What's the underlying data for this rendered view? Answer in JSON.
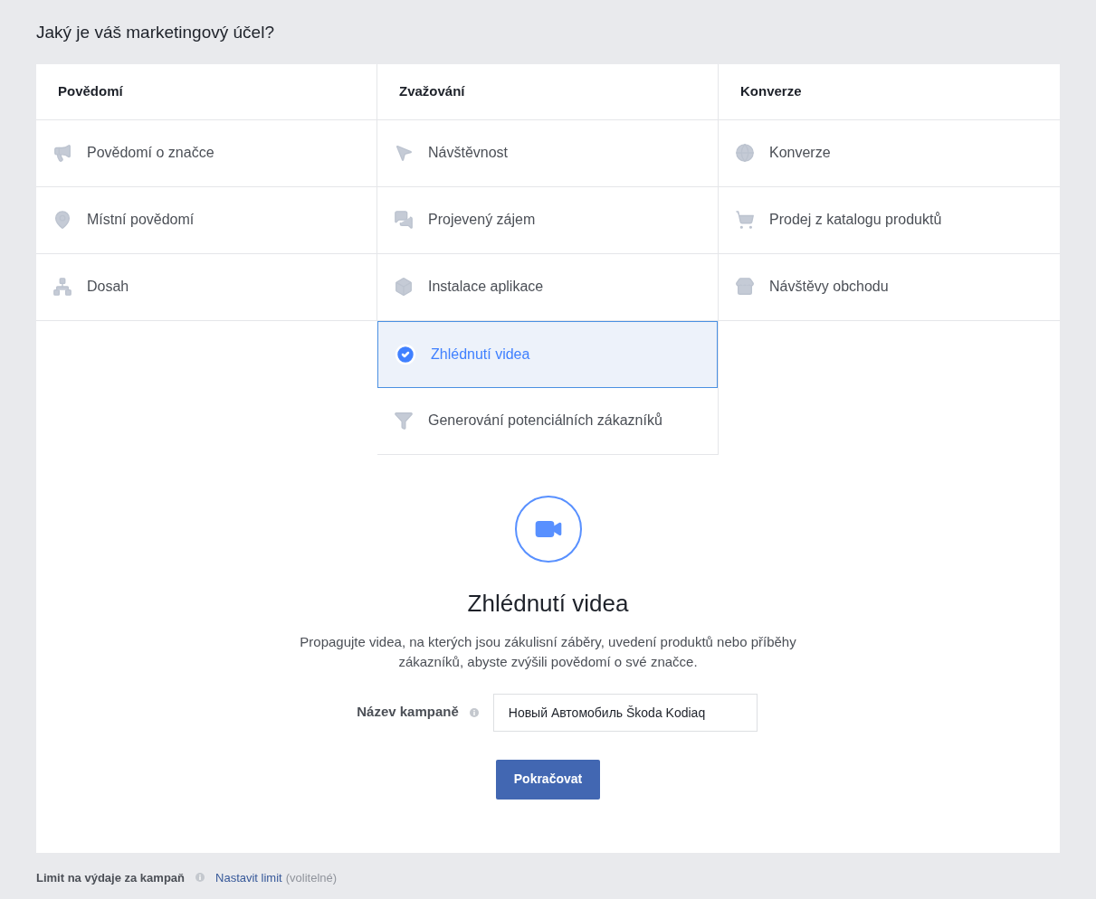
{
  "title": "Jaký je váš marketingový účel?",
  "columns": [
    {
      "heading": "Povědomí",
      "items": [
        {
          "label": "Povědomí o značce",
          "kind": "megaphone",
          "selected": false
        },
        {
          "label": "Místní povědomí",
          "kind": "pin",
          "selected": false
        },
        {
          "label": "Dosah",
          "kind": "network",
          "selected": false
        }
      ]
    },
    {
      "heading": "Zvažování",
      "items": [
        {
          "label": "Návštěvnost",
          "kind": "cursor",
          "selected": false
        },
        {
          "label": "Projevený zájem",
          "kind": "chat",
          "selected": false
        },
        {
          "label": "Instalace aplikace",
          "kind": "cube",
          "selected": false
        },
        {
          "label": "Zhlédnutí videa",
          "selected": true
        },
        {
          "label": "Generování potenciálních zákazníků",
          "kind": "funnel",
          "selected": false
        }
      ]
    },
    {
      "heading": "Konverze",
      "items": [
        {
          "label": "Konverze",
          "kind": "globe",
          "selected": false
        },
        {
          "label": "Prodej z katalogu produktů",
          "kind": "cart",
          "selected": false
        },
        {
          "label": "Návštěvy obchodu",
          "kind": "store",
          "selected": false
        }
      ]
    }
  ],
  "detail": {
    "kind": "video",
    "title": "Zhlédnutí videa",
    "description": "Propagujte videa, na kterých jsou zákulisní záběry, uvedení produktů nebo příběhy zákazníků, abyste zvýšili povědomí o své značce.",
    "field_label": "Název kampaně",
    "field_value": "Новый Автомобиль Škoda Kodiaq",
    "button": "Pokračovat"
  },
  "footer": {
    "label": "Limit na výdaje za kampaň",
    "link": "Nastavit limit",
    "note": "(volitelné)"
  }
}
